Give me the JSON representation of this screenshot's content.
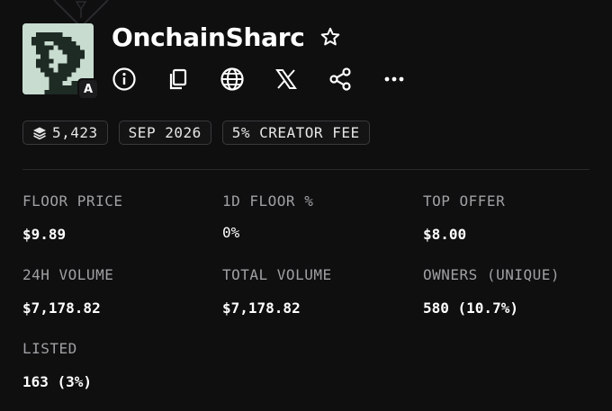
{
  "collection": {
    "name": "OnchainSharc",
    "chain_badge": "A",
    "avatar_colors": {
      "background": "#c8dccf",
      "pixel": "#1e2a24"
    }
  },
  "actions": [
    {
      "icon": "info-icon"
    },
    {
      "icon": "copy-icon"
    },
    {
      "icon": "globe-icon"
    },
    {
      "icon": "x-logo-icon"
    },
    {
      "icon": "share-icon"
    },
    {
      "icon": "more-icon"
    }
  ],
  "pills": {
    "items_count": "5,423",
    "date": "SEP 2026",
    "creator_fee": "5% CREATOR FEE"
  },
  "stats": {
    "floor_price": {
      "label": "FLOOR PRICE",
      "value": "$9.89"
    },
    "floor_change": {
      "label": "1D FLOOR %",
      "value": "0%"
    },
    "top_offer": {
      "label": "TOP OFFER",
      "value": "$8.00"
    },
    "volume_24h": {
      "label": "24H VOLUME",
      "value": "$7,178.82"
    },
    "total_volume": {
      "label": "TOTAL VOLUME",
      "value": "$7,178.82"
    },
    "owners": {
      "label": "OWNERS (UNIQUE)",
      "value": "580 (10.7%)"
    },
    "listed": {
      "label": "LISTED",
      "value": "163 (3%)"
    }
  },
  "colors": {
    "background": "#0f0f10",
    "label": "#a0a0a4",
    "value": "#ffffff",
    "pill_border": "#3a3a3d"
  }
}
